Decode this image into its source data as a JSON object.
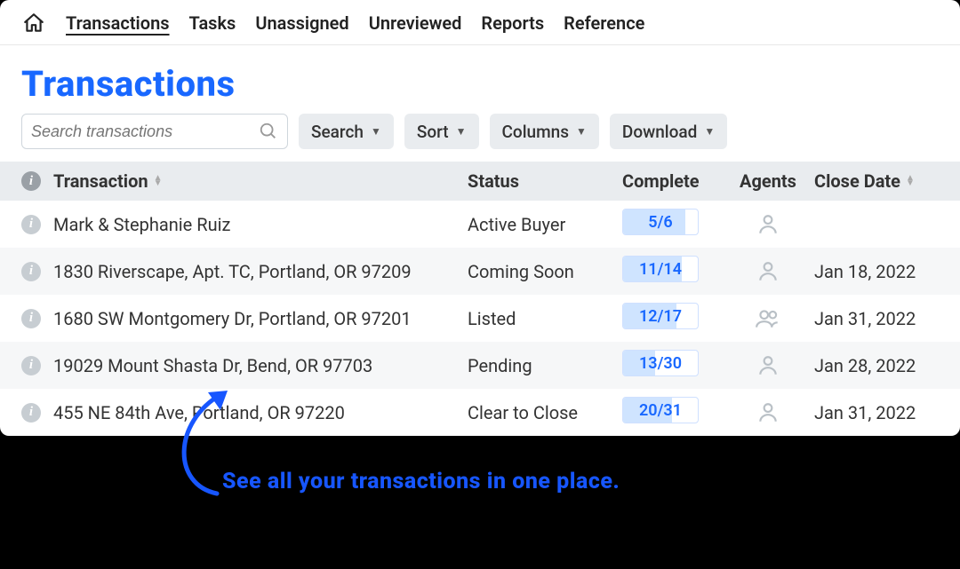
{
  "nav": {
    "items": [
      "Transactions",
      "Tasks",
      "Unassigned",
      "Unreviewed",
      "Reports",
      "Reference"
    ],
    "active_index": 0
  },
  "page": {
    "title": "Transactions"
  },
  "search": {
    "placeholder": "Search transactions"
  },
  "toolbar": {
    "search_label": "Search",
    "sort_label": "Sort",
    "columns_label": "Columns",
    "download_label": "Download"
  },
  "columns": {
    "transaction": "Transaction",
    "status": "Status",
    "complete": "Complete",
    "agents": "Agents",
    "close_date": "Close Date"
  },
  "rows": [
    {
      "name": "Mark & Stephanie Ruiz",
      "status": "Active Buyer",
      "complete": "5/6",
      "fill_pct": 83,
      "agents": 1,
      "close_date": ""
    },
    {
      "name": "1830 Riverscape, Apt. TC, Portland, OR 97209",
      "status": "Coming Soon",
      "complete": "11/14",
      "fill_pct": 79,
      "agents": 1,
      "close_date": "Jan 18, 2022"
    },
    {
      "name": "1680 SW Montgomery Dr, Portland, OR 97201",
      "status": "Listed",
      "complete": "12/17",
      "fill_pct": 71,
      "agents": 2,
      "close_date": "Jan 31, 2022"
    },
    {
      "name": "19029 Mount Shasta Dr, Bend, OR 97703",
      "status": "Pending",
      "complete": "13/30",
      "fill_pct": 43,
      "agents": 1,
      "close_date": "Jan 28, 2022"
    },
    {
      "name": "455 NE 84th Ave, Portland, OR 97220",
      "status": "Clear to Close",
      "complete": "20/31",
      "fill_pct": 65,
      "agents": 1,
      "close_date": "Jan 31, 2022"
    }
  ],
  "annotation": {
    "text": "See all your transactions in one place."
  },
  "colors": {
    "accent": "#1968ff",
    "pill_fill": "#cfe4ff"
  }
}
